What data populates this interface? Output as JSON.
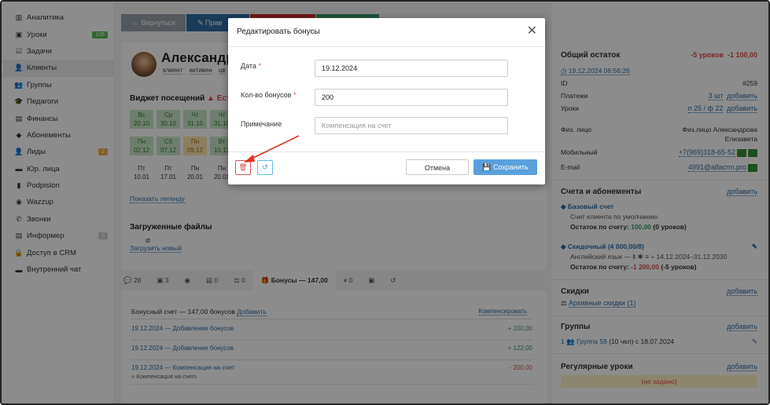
{
  "sidebar": {
    "items": [
      {
        "label": "Аналитика",
        "icon": "chart-icon",
        "ic": "▥"
      },
      {
        "label": "Уроки",
        "icon": "calendar-icon",
        "ic": "▣",
        "badge": "106",
        "badge_color": "#5cb85c"
      },
      {
        "label": "Задачи",
        "icon": "tasks-icon",
        "ic": "☑"
      },
      {
        "label": "Клиенты",
        "icon": "user-icon",
        "ic": "👤"
      },
      {
        "label": "Группы",
        "icon": "users-icon",
        "ic": "👥"
      },
      {
        "label": "Педагоги",
        "icon": "graduation-cap-icon",
        "ic": "🎓"
      },
      {
        "label": "Финансы",
        "icon": "money-icon",
        "ic": "▤"
      },
      {
        "label": "Абонементы",
        "icon": "tag-icon",
        "ic": "◆"
      },
      {
        "label": "Лиды",
        "icon": "leads-icon",
        "ic": "👤",
        "badge": "2",
        "badge_color": "#f0ad4e"
      },
      {
        "label": "Юр. лица",
        "icon": "briefcase-icon",
        "ic": "▬"
      },
      {
        "label": "Podpislon",
        "icon": "document-icon",
        "ic": "▮"
      },
      {
        "label": "Wazzup",
        "icon": "whatsapp-icon",
        "ic": "◉"
      },
      {
        "label": "Звонки",
        "icon": "phone-icon",
        "ic": "✆"
      },
      {
        "label": "Информер",
        "icon": "informer-icon",
        "ic": "▤",
        "badge": "3",
        "badge_color": "#d0d0d0"
      },
      {
        "label": "Доступ в CRM",
        "icon": "lock-icon",
        "ic": "🔒"
      },
      {
        "label": "Внутренний чат",
        "icon": "chat-icon",
        "ic": "▬"
      }
    ],
    "active": 3
  },
  "top_buttons": {
    "back": "← Вернуться",
    "edit": "✎ Прав"
  },
  "client": {
    "name": "Александров",
    "tags": [
      "клиент",
      "активен",
      "цв"
    ]
  },
  "widget": {
    "title": "Виджет посещений",
    "warning": "▲ Есть"
  },
  "visits": [
    {
      "d": "Вс",
      "n": "20.10",
      "c": "g"
    },
    {
      "d": "Ср",
      "n": "30.10",
      "c": "g"
    },
    {
      "d": "Чт",
      "n": "31.10",
      "c": "g"
    },
    {
      "d": "Чт",
      "n": "31.10",
      "c": "g"
    },
    {
      "d": "Пн",
      "n": "02.12",
      "c": "g"
    },
    {
      "d": "Сб",
      "n": "07.12",
      "c": "g"
    },
    {
      "d": "Пн",
      "n": "09.12",
      "c": "y"
    },
    {
      "d": "Вт",
      "n": "10.12",
      "c": "g"
    },
    {
      "d": "Пт",
      "n": "10.01",
      "c": "w"
    },
    {
      "d": "Пт",
      "n": "17.01",
      "c": "w"
    },
    {
      "d": "Пн",
      "n": "20.01",
      "c": "w"
    },
    {
      "d": "Пн",
      "n": "20.01",
      "c": "w"
    }
  ],
  "legend_link": "Показать легенду",
  "files": {
    "title": "Загруженные файлы",
    "upload": "Загрузить новый"
  },
  "tabs": [
    "💬 28",
    "▣ 3",
    "◉",
    "▤ 0",
    "⚖ 0",
    "🎁 Бонусы — 147,00",
    "⏸ 0",
    "▣",
    "↺"
  ],
  "bonus": {
    "account": "Бонусный счет — 147,00 бонусов",
    "add": "Добавить",
    "compensate": "Компенсировать",
    "rows": [
      {
        "t": "19.12.2024 — Добавление бонусов",
        "v": "+ 200,00",
        "neg": false,
        "note": ""
      },
      {
        "t": "19.12.2024 — Добавление бонусов",
        "v": "+ 122,00",
        "neg": false,
        "note": ""
      },
      {
        "t": "19.12.2024 — Компенсация на счет",
        "v": "- 200,00",
        "neg": true,
        "note": "» Компенсация на счет"
      }
    ]
  },
  "right": {
    "total_label": "Общий остаток",
    "total_lessons": "-5 уроков",
    "total_money": "-1 100,00",
    "date": "◷ 19.12.2024 06:56:26",
    "id_label": "ID",
    "id_value": "#259",
    "pay_label": "Платежи",
    "pay_value": "3 шт",
    "pay_add": "добавить",
    "lessons_label": "Уроки",
    "lessons_value": "п 25 / ф 22",
    "lessons_add": "добавить",
    "person_label": "Физ. лицо",
    "person_value": "Физ.лицо Александрова",
    "person_value2": "Елизавета",
    "mobile_label": "Мобильный",
    "mobile_value": "+7(969)318-65-52",
    "email_label": "E-mail",
    "email_value": "4991@alfacrm.pro",
    "accounts_title": "Счета и абонементы",
    "accounts_add": "добавить",
    "base_acc": "Базовый счет",
    "base_desc": "Счет клиента по умолчанию",
    "base_bal_label": "Остаток по счету:",
    "base_bal": "100,00",
    "base_bal_tail": "(0 уроков)",
    "sub_acc": "Скидочный (4 000,00/8)",
    "sub_desc": "Английский язык — Ⅱ ✱ ≡ ÷ 14.12.2024–31.12.2030",
    "sub_bal_label": "Остаток по счету:",
    "sub_bal": "-1 200,00",
    "sub_bal_tail": "(-5 уроков)",
    "disc_title": "Скидки",
    "disc_add": "добавить",
    "disc_archive": "Архивные скидки (1)",
    "groups_title": "Группы",
    "groups_add": "добавить",
    "group_line": "Группа 58",
    "group_tail": "(10 чел) с 18.07.2024",
    "group_num": "1",
    "reg_title": "Регулярные уроки",
    "reg_add": "добавить",
    "reg_empty": "(не задано)"
  },
  "modal": {
    "title": "Редактировать бонусы",
    "date_label": "Дата",
    "date_value": "19.12.2024",
    "qty_label": "Кол-во бонусов",
    "qty_value": "200",
    "note_label": "Примечание",
    "note_placeholder": "Компенсация на счет",
    "cancel": "Отмена",
    "save": "💾 Сохранить"
  },
  "colors": {
    "accent": "#4a90d9",
    "danger": "#d9534f",
    "green": "#5cb85c",
    "save": "#5aa0dc"
  }
}
